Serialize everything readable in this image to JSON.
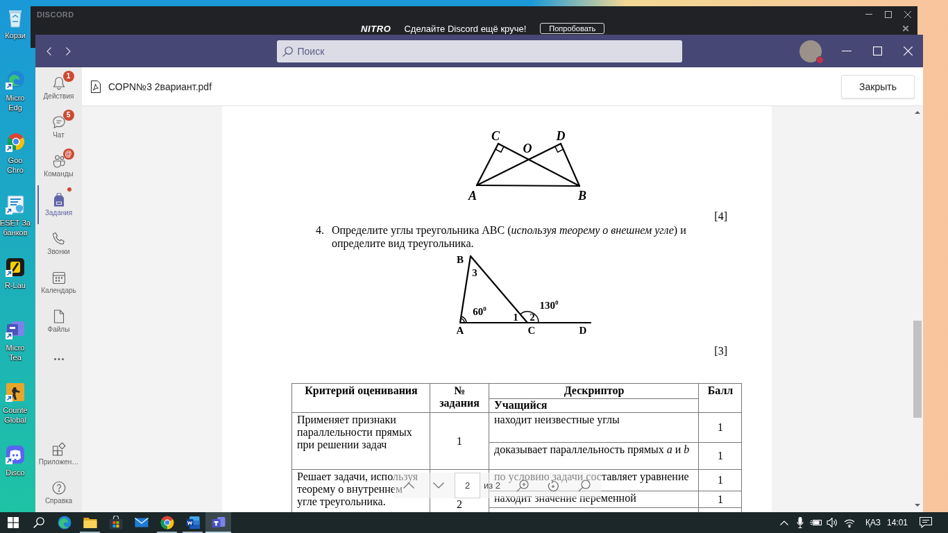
{
  "desktop": {
    "shortcuts": [
      {
        "label_lines": [
          "Корзи"
        ]
      },
      {
        "label_lines": [
          "Micro",
          "Edg"
        ]
      },
      {
        "label_lines": [
          "Goo",
          "Chro"
        ]
      },
      {
        "label_lines": [
          "ESET За",
          "банков"
        ]
      },
      {
        "label_lines": [
          "R-Lau"
        ]
      },
      {
        "label_lines": [
          "Micro",
          "Tea"
        ]
      },
      {
        "label_lines": [
          "Counte",
          "Global"
        ]
      },
      {
        "label_lines": [
          "Disco"
        ]
      }
    ]
  },
  "back_window": {
    "wordmark": "DISCORD",
    "promo": {
      "logo": "NITRO",
      "text": "Сделайте Discord ещё круче!",
      "button": "Попробовать"
    }
  },
  "window": {
    "search": {
      "placeholder": "Поиск"
    },
    "user": {
      "busy": true
    }
  },
  "rail": {
    "items": [
      {
        "label": "Действия",
        "badge": "1",
        "dot": false,
        "selected": false
      },
      {
        "label": "Чат",
        "badge": "5",
        "dot": false,
        "selected": false
      },
      {
        "label": "Команды",
        "badge": "@",
        "dot": false,
        "selected": false
      },
      {
        "label": "Задания",
        "dot": true,
        "selected": true
      },
      {
        "label": "Звонки",
        "dot": false,
        "selected": false
      },
      {
        "label": "Календарь",
        "dot": false,
        "selected": false
      },
      {
        "label": "Файлы",
        "dot": false,
        "selected": false
      }
    ],
    "bottom_items": [
      {
        "label": "Приложен…",
        "selected": false
      },
      {
        "label": "Справка",
        "selected": false
      }
    ]
  },
  "file": {
    "name": "СОРN№3 2вариант.pdf",
    "close_button": "Закрыть"
  },
  "document": {
    "figure_1": {
      "labels": [
        "C",
        "D",
        "O",
        "A",
        "B"
      ]
    },
    "score_1": "[4]",
    "task": {
      "number": "4.",
      "text": "Определите углы треугольника АВС (*используя теорему о внешнем угле*) и определите вид треугольника."
    },
    "figure_2": {
      "labels": [
        "B",
        "3",
        "60$^{0}$",
        "1",
        "2",
        "130$^{0}$",
        "A",
        "C",
        "D"
      ]
    },
    "score_2": "[3]",
    "table": {
      "columns": [
        "Критерий оценивания",
        "№ задания",
        "Дескриптор",
        "Балл"
      ],
      "subheader": "Учащийся",
      "rows": [
        {
          "criterion": "Применяет признаки параллельности прямых при решении задач",
          "task": "1",
          "descriptors": [
            {
              "text": "находит неизвестные углы",
              "score": "1"
            },
            {
              "text": "доказывает параллельность прямых *a* и *b*",
              "score": "1"
            }
          ]
        },
        {
          "criterion": "Решает задачи, используя теорему о внутреннем угле треугольника.",
          "task": "2",
          "descriptors": [
            {
              "text": "по условию задачи составляет уравнение",
              "score": "1"
            },
            {
              "text": "находит значение переменной",
              "score": "1"
            }
          ]
        }
      ]
    }
  },
  "pdf_toolbar": {
    "page": "2",
    "page_count": "из 2"
  },
  "taskbar": {
    "apps": [
      {
        "running": false,
        "active": false
      },
      {
        "running": true,
        "active": false
      },
      {
        "running": false,
        "active": false
      },
      {
        "running": false,
        "active": false
      },
      {
        "running": true,
        "active": false
      },
      {
        "running": true,
        "active": false
      },
      {
        "running": true,
        "active": true
      }
    ],
    "language": "ҚАЗ",
    "time": "14:01"
  }
}
